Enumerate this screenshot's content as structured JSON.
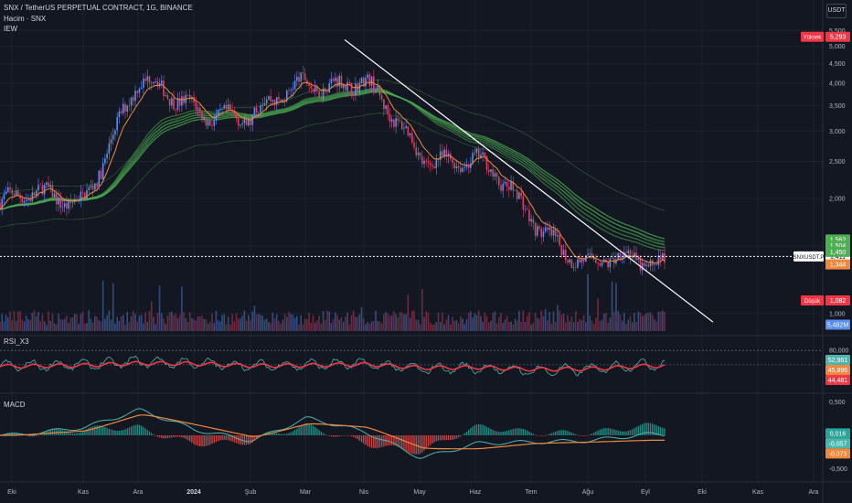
{
  "header": {
    "symbol_title": "SNX / TetherUS PERPETUAL CONTRACT, 1G, BINANCE",
    "volume_label": "Hacim · SNX",
    "indicator_label": "IEW",
    "currency": "USDT"
  },
  "panes": {
    "rsi_label": "RSI_X3",
    "macd_label": "MACD"
  },
  "colors": {
    "background": "#131722",
    "grid": "#1e222d",
    "candle_up": "#5b8def",
    "candle_down": "#e2405a",
    "ema_fast": "#f0873b",
    "ribbon": "#4caf50",
    "trendline": "#ffffff",
    "rsi_fast": "#4db6ac",
    "rsi_slow": "#f23645",
    "macd_line": "#4db6ac",
    "signal_line": "#f0873b"
  },
  "chart_data": [
    {
      "type": "candlestick",
      "title": "SNX / TetherUS PERPETUAL CONTRACT, 1G, BINANCE",
      "x_axis": {
        "labels": [
          "Eki",
          "Kas",
          "Ara",
          "2024",
          "Şub",
          "Mar",
          "Nis",
          "May",
          "Haz",
          "Tem",
          "Ağu",
          "Eyl",
          "Eki",
          "Kas",
          "Ara"
        ]
      },
      "y_axis": {
        "scale": "log",
        "ticks": [
          "5,500",
          "5,000",
          "4,500",
          "4,000",
          "3,500",
          "3,000",
          "2,500",
          "2,000",
          "1,500",
          "1,000"
        ],
        "range": [
          0.9,
          5.6
        ]
      },
      "monthly_path": {
        "months": [
          "Eki",
          "Kas",
          "Ara",
          "2024",
          "Şub",
          "Mar",
          "Nis",
          "May",
          "Haz",
          "Tem",
          "Ağu",
          "Eyl"
        ],
        "approx_close": [
          1.95,
          2.05,
          3.9,
          3.6,
          3.1,
          4.2,
          3.9,
          2.7,
          2.45,
          1.85,
          1.3,
          1.41
        ]
      },
      "price_labels": [
        {
          "name": "Yüksek",
          "value": "5,293"
        },
        {
          "name": "SNXUSDT.P",
          "value": "1,411"
        },
        {
          "name": "Düşük",
          "value": "1,082"
        },
        {
          "name": "level-1",
          "value": "1,562"
        },
        {
          "name": "level-2",
          "value": "1,504"
        },
        {
          "name": "level-3",
          "value": "1,450"
        },
        {
          "name": "level-4",
          "value": "1,344"
        },
        {
          "name": "volume",
          "value": "5,482M"
        }
      ],
      "trendline": {
        "from": {
          "date": "Mar",
          "price": 5.2
        },
        "to": {
          "date": "Eki",
          "price": 0.95
        }
      },
      "current_price": 1.411,
      "high": 5.293,
      "low": 1.082
    },
    {
      "type": "line",
      "title": "RSI_X3",
      "y_axis": {
        "ticks": [
          "80,000"
        ],
        "range": [
          0,
          100
        ]
      },
      "series": [
        {
          "values": [
            50,
            52,
            58,
            55,
            50,
            52,
            54,
            44,
            46,
            40,
            43,
            53
          ]
        },
        {
          "values": [
            49,
            51,
            55,
            54,
            50,
            51,
            53,
            46,
            47,
            43,
            44,
            50
          ]
        }
      ],
      "value_labels": [
        "52,961",
        "45,896",
        "44,481"
      ]
    },
    {
      "type": "line",
      "title": "MACD",
      "y_axis": {
        "ticks": [
          "0,500",
          "-0,500"
        ],
        "range": [
          -0.6,
          0.6
        ]
      },
      "series": [
        {
          "values": [
            0.0,
            0.12,
            0.38,
            0.08,
            -0.08,
            0.26,
            0.05,
            -0.34,
            -0.12,
            -0.1,
            -0.08,
            0.016
          ]
        },
        {
          "values": [
            0.0,
            0.07,
            0.32,
            0.15,
            -0.03,
            0.18,
            0.12,
            -0.2,
            -0.2,
            -0.12,
            -0.1,
            -0.073
          ]
        }
      ],
      "value_labels": [
        "0,016",
        "-0,057",
        "-0,073"
      ]
    }
  ]
}
